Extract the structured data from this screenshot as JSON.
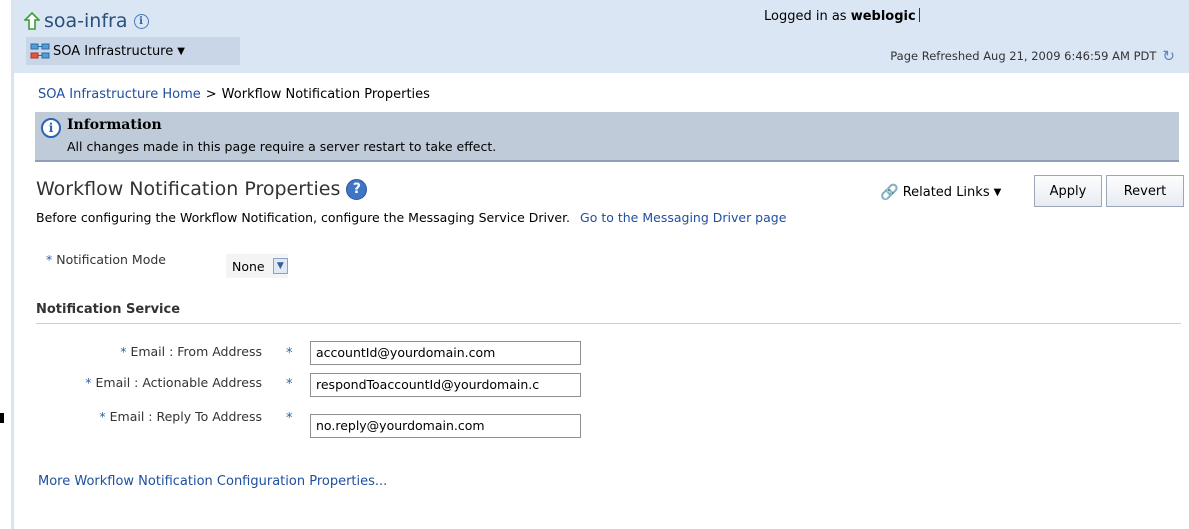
{
  "header": {
    "title": "soa-infra",
    "menu_label": "SOA Infrastructure",
    "logged_in_prefix": "Logged in as",
    "username": "weblogic",
    "page_refreshed": "Page Refreshed Aug 21, 2009 6:46:59 AM PDT"
  },
  "breadcrumb": {
    "home": "SOA Infrastructure Home",
    "separator": ">",
    "current": "Workflow Notification Properties"
  },
  "info": {
    "title": "Information",
    "message": "All changes made in this page require a server restart to take effect."
  },
  "page": {
    "title": "Workflow Notification Properties",
    "related_links": "Related Links",
    "apply_label": "Apply",
    "revert_label": "Revert",
    "description": "Before configuring the Workflow Notification, configure the Messaging Service Driver.",
    "driver_link": "Go to the Messaging Driver page"
  },
  "form": {
    "required_marker": "*",
    "notification_mode": {
      "label": "Notification Mode",
      "value": "None"
    },
    "section_title": "Notification Service",
    "fields": [
      {
        "label": "Email : From Address",
        "value": "accountId@yourdomain.com"
      },
      {
        "label": "Email : Actionable Address",
        "value": "respondToaccountId@yourdomain.c"
      },
      {
        "label": "Email : Reply To Address",
        "value": "no.reply@yourdomain.com"
      }
    ]
  },
  "more_link": "More Workflow Notification Configuration Properties...",
  "colors": {
    "header_bg": "#dbe6f5",
    "info_bg": "#bfcbd9",
    "link": "#1f4fa0"
  }
}
